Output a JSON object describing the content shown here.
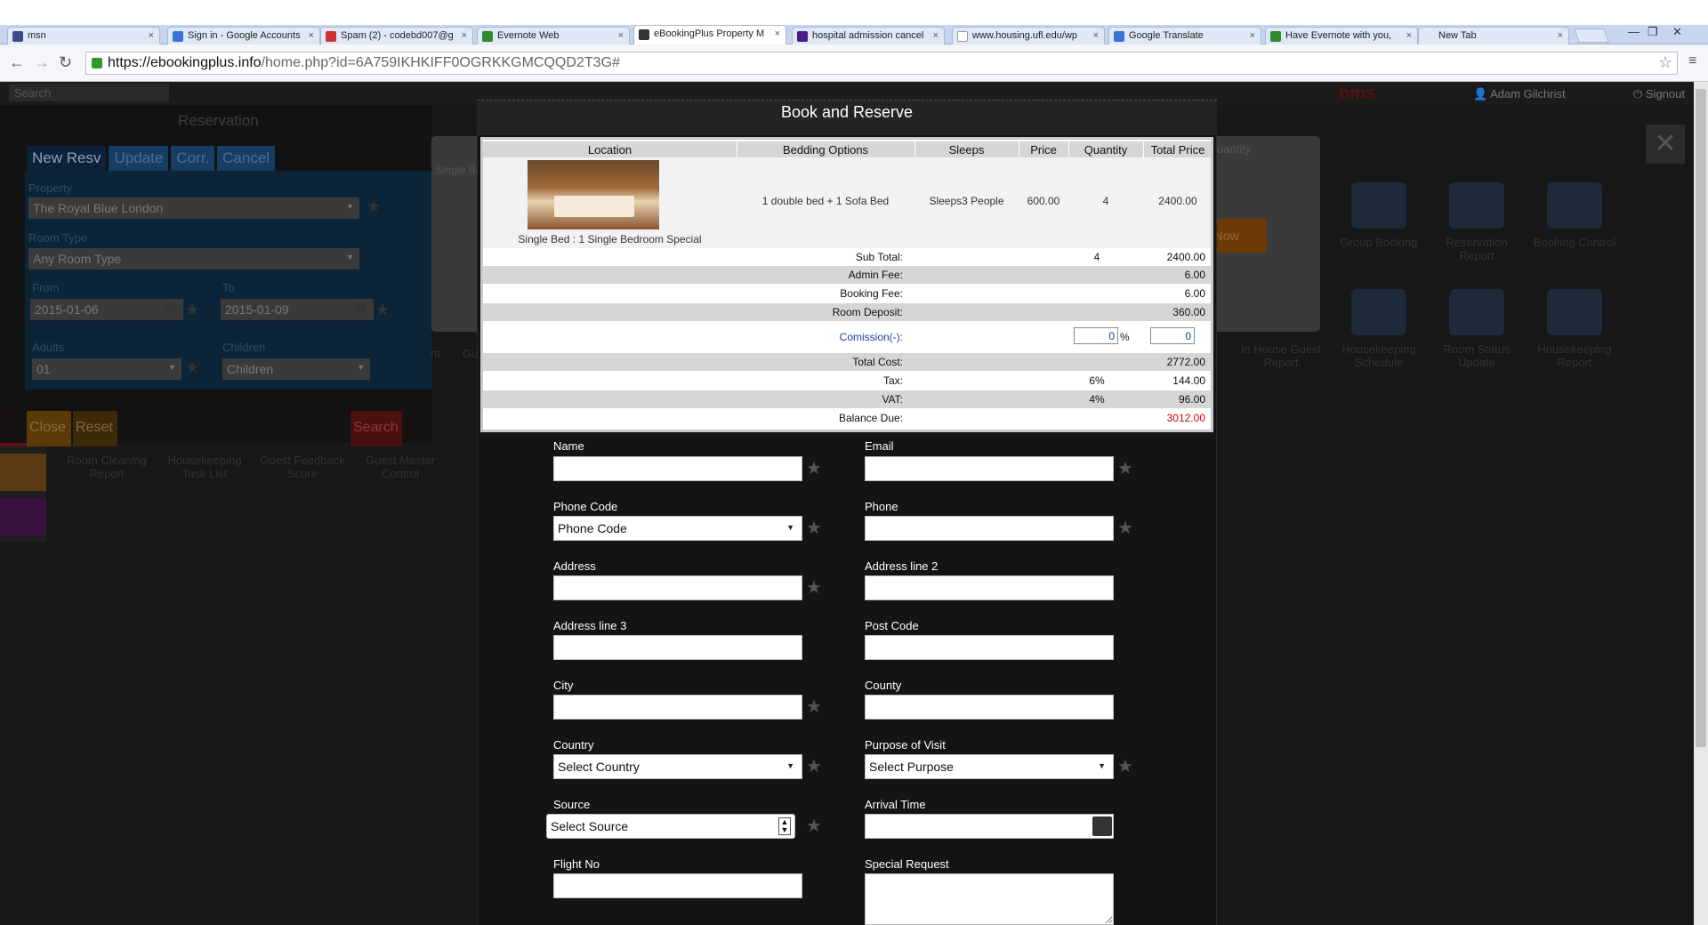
{
  "browser": {
    "tabs": [
      {
        "title": "msn",
        "fav": "#3b4a8c"
      },
      {
        "title": "Sign in - Google Accounts",
        "fav": "#3b72d8"
      },
      {
        "title": "Spam (2) - codebd007@g",
        "fav": "#cc3333"
      },
      {
        "title": "Evernote Web",
        "fav": "#2f8a2f"
      },
      {
        "title": "eBookingPlus Property M",
        "fav": "#333333"
      },
      {
        "title": "hospital admission cancel",
        "fav": "#4b1c8c"
      },
      {
        "title": "www.housing.ufl.edu/wp",
        "fav": "#ffffff"
      },
      {
        "title": "Google Translate",
        "fav": "#3b72d8"
      },
      {
        "title": "Have Evernote with you,",
        "fav": "#2f8a2f"
      },
      {
        "title": "New Tab",
        "fav": "none"
      }
    ],
    "url_host": "https://ebookingplus.info",
    "url_path": "/home.php?id=6A759IKHKIFF0OGRKKGMCQQD2T3G#"
  },
  "app": {
    "search_placeholder": "Search",
    "logo": "hms",
    "user": "Adam Gilchrist",
    "signout": "Signout",
    "reservation": {
      "title": "Reservation",
      "tabs": [
        "New Resv",
        "Update",
        "Corr.",
        "Cancel"
      ],
      "property_label": "Property",
      "property_value": "The Royal Blue London",
      "room_type_label": "Room Type",
      "room_type_value": "Any Room Type",
      "from_label": "From",
      "from_value": "2015-01-06",
      "to_label": "To",
      "to_value": "2015-01-09",
      "adults_label": "Adults",
      "adults_value": "01",
      "children_label": "Children",
      "children_value": "Children",
      "close": "Close",
      "reset": "Reset",
      "search": "Search"
    },
    "bg_popup": {
      "single_bed": "Single Be",
      "quantity": "uantity",
      "book_now": "ok Now"
    },
    "tiles": [
      "Group Booking",
      "Reservation Report",
      "Booking Control",
      "In House Guest Report",
      "Housekeeping Schedule",
      "Room Status Update",
      "Housekeeping Report",
      "Room Cleaning Report",
      "Housekeeping Task List",
      "Guest Feedback Score",
      "Guest Master Control"
    ],
    "tile_fragments": [
      "nt",
      "Gu"
    ]
  },
  "modal": {
    "title": "Book and Reserve",
    "headers": [
      "Location",
      "Bedding Options",
      "Sleeps",
      "Price",
      "Quantity",
      "Total Price"
    ],
    "room": {
      "name": "Single Bed : 1 Single Bedroom Special",
      "bedding": "1 double bed + 1 Sofa Bed",
      "sleeps": "Sleeps3 People",
      "price": "600.00",
      "quantity": "4",
      "total": "2400.00"
    },
    "summary": [
      {
        "label": "Sub Total:",
        "mid": "4",
        "value": "2400.00"
      },
      {
        "label": "Admin Fee:",
        "mid": "",
        "value": "6.00"
      },
      {
        "label": "Booking Fee:",
        "mid": "",
        "value": "6.00"
      },
      {
        "label": "Room Deposit:",
        "mid": "",
        "value": "360.00"
      }
    ],
    "commission": {
      "label": "Comission(-):",
      "percent": "0",
      "percent_sign": "%",
      "amount": "0"
    },
    "totals": [
      {
        "label": "Total Cost:",
        "mid": "",
        "value": "2772.00"
      },
      {
        "label": "Tax:",
        "mid": "6%",
        "value": "144.00"
      },
      {
        "label": "VAT:",
        "mid": "4%",
        "value": "96.00"
      }
    ],
    "balance": {
      "label": "Balance Due:",
      "value": "3012.00"
    },
    "form": {
      "name": "Name",
      "email": "Email",
      "phone_code": "Phone Code",
      "phone_code_value": "Phone Code",
      "phone": "Phone",
      "address": "Address",
      "address2": "Address line 2",
      "address3": "Address line 3",
      "post_code": "Post Code",
      "city": "City",
      "county": "County",
      "country": "Country",
      "country_value": "Select Country",
      "purpose": "Purpose of Visit",
      "purpose_value": "Select Purpose",
      "source": "Source",
      "source_value": "Select Source",
      "arrival": "Arrival Time",
      "flight": "Flight No",
      "special": "Special Request"
    }
  },
  "colors": {
    "balance": "#d40000",
    "commission": "#1a3fa8",
    "accent_blue": "#0c2438"
  }
}
